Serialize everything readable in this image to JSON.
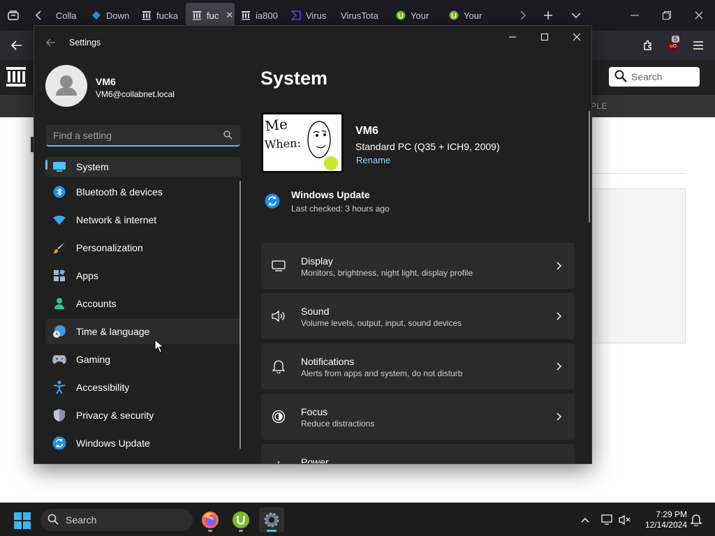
{
  "browser": {
    "tabs": [
      {
        "label": "Colla",
        "icon": "doc-icon",
        "active": false
      },
      {
        "label": "Down",
        "icon": "malwarebytes-icon",
        "active": false
      },
      {
        "label": "fucka",
        "icon": "archive-icon",
        "active": false
      },
      {
        "label": "fuc",
        "icon": "archive-icon",
        "active": true
      },
      {
        "label": "ia800",
        "icon": "archive-icon",
        "active": false
      },
      {
        "label": "Virus",
        "icon": "virustotal-icon",
        "active": false
      },
      {
        "label": "VirusTota",
        "icon": "none",
        "active": false
      },
      {
        "label": "Your",
        "icon": "utorrent-icon",
        "active": false
      },
      {
        "label": "Your",
        "icon": "utorrent-icon",
        "active": false
      }
    ],
    "extension_badge": "5",
    "site_search_placeholder": "Search",
    "site_subnav_text": "PLE"
  },
  "settings": {
    "window_title": "Settings",
    "profile": {
      "name": "VM6",
      "email": "VM6@collabnet.local"
    },
    "find_placeholder": "Find a setting",
    "nav": [
      {
        "label": "System",
        "icon": "system-icon",
        "state": "selected"
      },
      {
        "label": "Bluetooth & devices",
        "icon": "bluetooth-icon",
        "state": ""
      },
      {
        "label": "Network & internet",
        "icon": "wifi-icon",
        "state": ""
      },
      {
        "label": "Personalization",
        "icon": "brush-icon",
        "state": ""
      },
      {
        "label": "Apps",
        "icon": "apps-icon",
        "state": ""
      },
      {
        "label": "Accounts",
        "icon": "accounts-icon",
        "state": ""
      },
      {
        "label": "Time & language",
        "icon": "globe-clock-icon",
        "state": "hovered"
      },
      {
        "label": "Gaming",
        "icon": "gamepad-icon",
        "state": ""
      },
      {
        "label": "Accessibility",
        "icon": "accessibility-icon",
        "state": ""
      },
      {
        "label": "Privacy & security",
        "icon": "shield-icon",
        "state": ""
      },
      {
        "label": "Windows Update",
        "icon": "windows-update-icon",
        "state": ""
      }
    ],
    "page_title": "System",
    "device": {
      "name": "VM6",
      "model": "Standard PC (Q35 + ICH9, 2009)",
      "rename": "Rename",
      "thumb_text_line1": "Me",
      "thumb_text_line2": "When:"
    },
    "update": {
      "title": "Windows Update",
      "subtitle": "Last checked: 3 hours ago"
    },
    "cards": [
      {
        "title": "Display",
        "subtitle": "Monitors, brightness, night light, display profile",
        "icon": "display-icon"
      },
      {
        "title": "Sound",
        "subtitle": "Volume levels, output, input, sound devices",
        "icon": "sound-icon"
      },
      {
        "title": "Notifications",
        "subtitle": "Alerts from apps and system, do not disturb",
        "icon": "bell-icon"
      },
      {
        "title": "Focus",
        "subtitle": "Reduce distractions",
        "icon": "focus-icon"
      },
      {
        "title": "Power",
        "subtitle": "",
        "icon": "power-icon"
      }
    ]
  },
  "taskbar": {
    "search_label": "Search",
    "time": "7:29 PM",
    "date": "12/14/2024"
  },
  "colors": {
    "accent": "#4cc2ff",
    "window_bg": "#202020",
    "card_bg": "#2b2b2b"
  }
}
